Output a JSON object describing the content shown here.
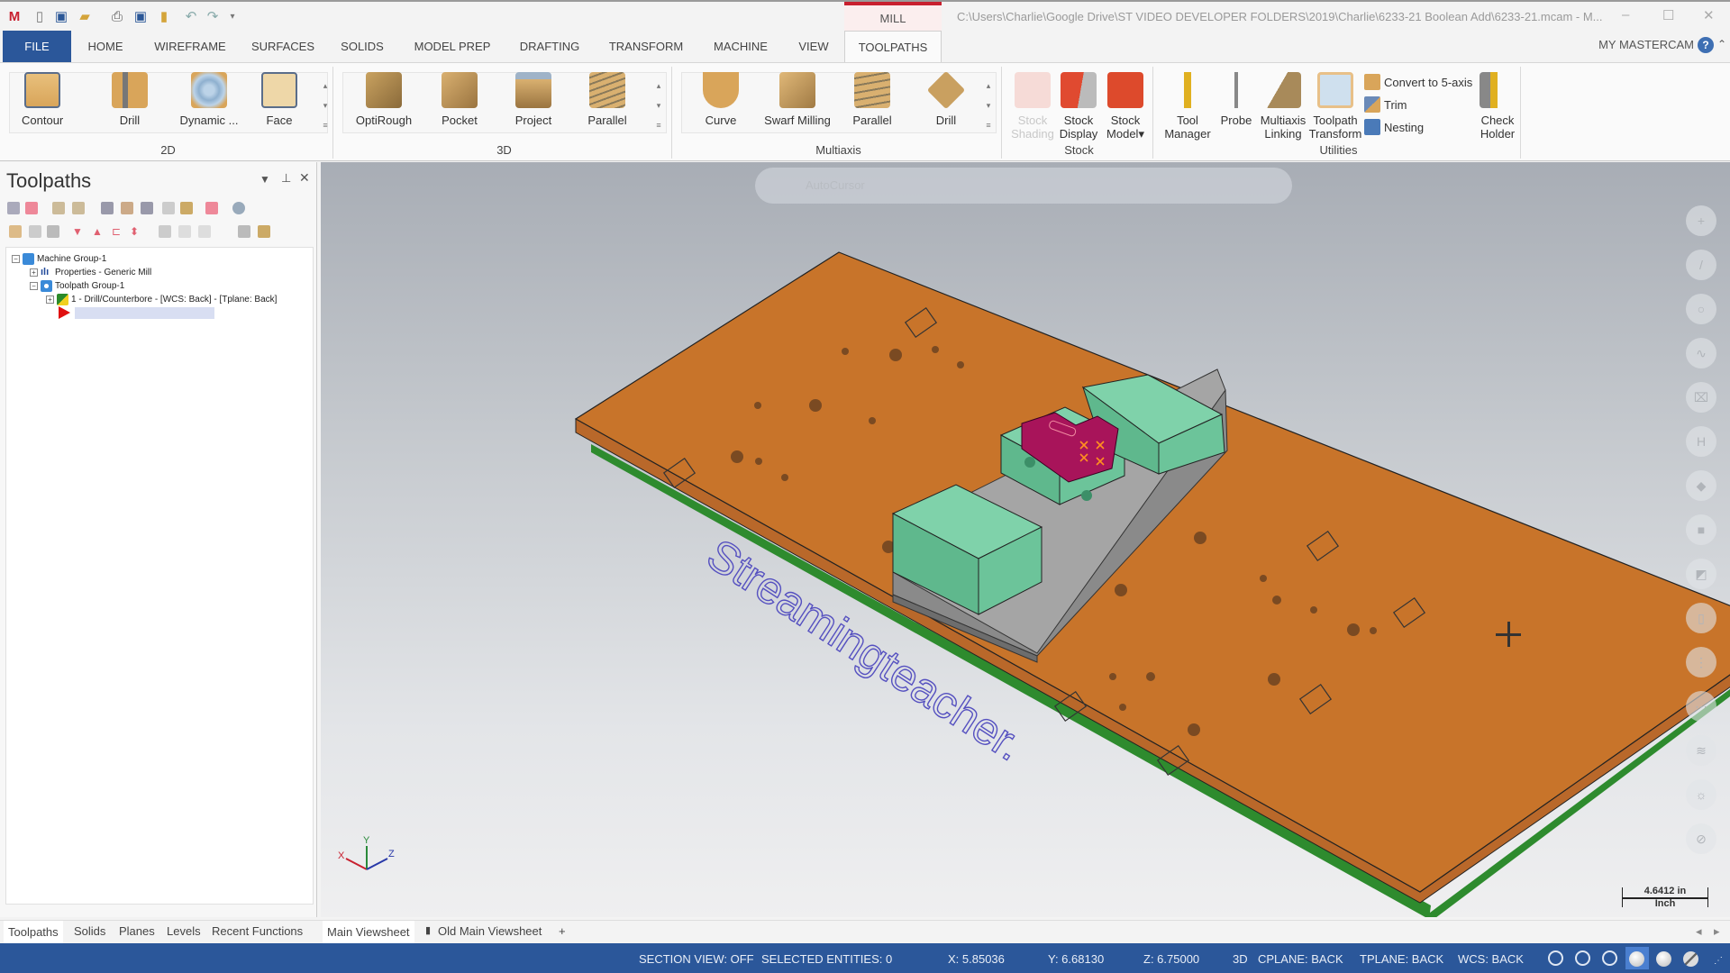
{
  "title_bar": {
    "context_tab": "MILL",
    "file_path": "C:\\Users\\Charlie\\Google Drive\\ST VIDEO DEVELOPER FOLDERS\\2019\\Charlie\\6233-21 Boolean Add\\6233-21.mcam - M...",
    "quick_access": [
      "new-icon",
      "save-icon",
      "open-icon",
      "print-icon",
      "save-as-icon",
      "folder-icon",
      "undo-icon",
      "redo-icon",
      "customize-icon"
    ],
    "window_buttons": {
      "minimize": "–",
      "maximize": "☐",
      "close": "✕"
    }
  },
  "ribbon_tabs": [
    "FILE",
    "HOME",
    "WIREFRAME",
    "SURFACES",
    "SOLIDS",
    "MODEL PREP",
    "DRAFTING",
    "TRANSFORM",
    "MACHINE",
    "VIEW",
    "TOOLPATHS"
  ],
  "active_tab": "TOOLPATHS",
  "my_mastercam": "MY MASTERCAM",
  "help_label": "?",
  "ribbon": {
    "group_2d": {
      "label": "2D",
      "buttons": [
        "Contour",
        "Drill",
        "Dynamic ...",
        "Face"
      ]
    },
    "group_3d": {
      "label": "3D",
      "buttons": [
        "OptiRough",
        "Pocket",
        "Project",
        "Parallel"
      ]
    },
    "group_multiaxis": {
      "label": "Multiaxis",
      "buttons": [
        "Curve",
        "Swarf Milling",
        "Parallel",
        "Drill"
      ]
    },
    "group_stock": {
      "label": "Stock",
      "buttons": [
        {
          "l1": "Stock",
          "l2": "Shading"
        },
        {
          "l1": "Stock",
          "l2": "Display"
        },
        {
          "l1": "Stock",
          "l2": "Model▾"
        }
      ]
    },
    "group_utilities": {
      "label": "Utilities",
      "buttons": [
        {
          "l1": "Tool",
          "l2": "Manager"
        },
        {
          "l1": "Probe",
          "l2": ""
        },
        {
          "l1": "Multiaxis",
          "l2": "Linking"
        },
        {
          "l1": "Toolpath",
          "l2": "Transform"
        }
      ],
      "small": [
        "Convert to 5-axis",
        "Trim",
        "Nesting"
      ]
    },
    "check_holder": {
      "l1": "Check",
      "l2": "Holder"
    }
  },
  "panel": {
    "title": "Toolpaths",
    "tree": [
      {
        "label": "Machine Group-1"
      },
      {
        "label": "Properties - Generic Mill"
      },
      {
        "label": "Toolpath Group-1"
      },
      {
        "label": "1 - Drill/Counterbore - [WCS: Back] - [Tplane: Back]"
      }
    ]
  },
  "bottom_tabs": [
    "Toolpaths",
    "Solids",
    "Planes",
    "Levels",
    "Recent Functions"
  ],
  "viewsheets": [
    "Main Viewsheet",
    "Old Main Viewsheet",
    "+"
  ],
  "floating_toolbar": {
    "autocursor": "AutoCursor"
  },
  "viewport": {
    "watermark": "Streamingteacher.",
    "scale_value": "4.6412 in",
    "scale_unit": "Inch",
    "axes": {
      "x": "X",
      "y": "Y",
      "z": "Z"
    },
    "colors": {
      "plate": "#c8742a",
      "vise": "#6fc49a",
      "part": "#a8145a",
      "base": "#2e8b2e"
    }
  },
  "status_bar": {
    "section_view": "SECTION VIEW: OFF",
    "selected": "SELECTED ENTITIES: 0",
    "x": "X:  5.85036",
    "y": "Y:  6.68130",
    "z": "Z:  6.75000",
    "mode": "3D",
    "cplane": "CPLANE: BACK",
    "tplane": "TPLANE: BACK",
    "wcs": "WCS: BACK"
  }
}
